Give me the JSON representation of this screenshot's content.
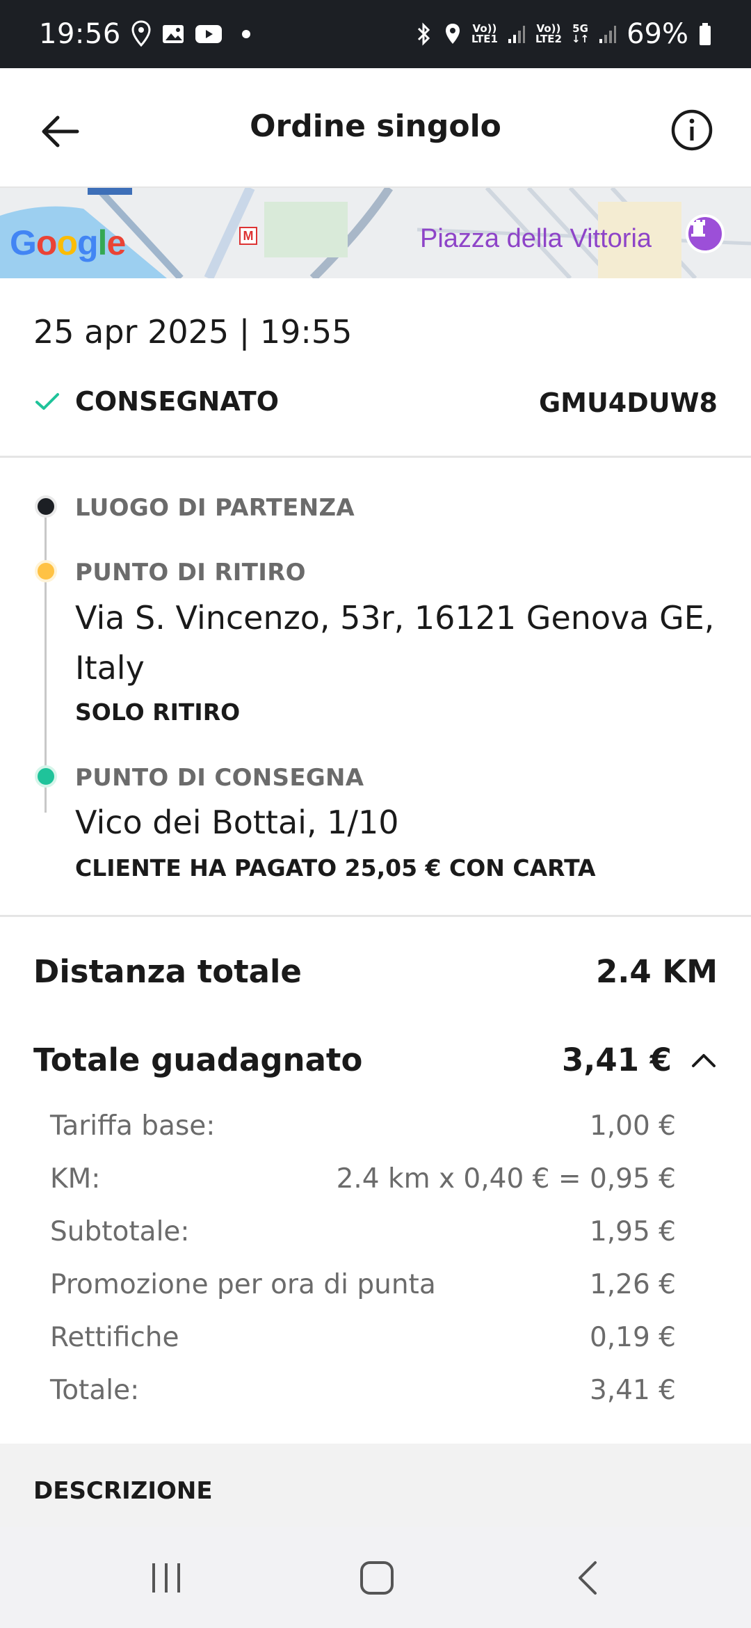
{
  "status_bar": {
    "time": "19:56",
    "sim1_top": "Vo))",
    "sim1_bottom": "LTE1",
    "sim2_top": "Vo))",
    "sim2_bottom": "LTE2",
    "network": "5G",
    "battery": "69%"
  },
  "header": {
    "title": "Ordine singolo"
  },
  "map": {
    "place_label": "Piazza della Vittoria",
    "google_letters": [
      "G",
      "o",
      "o",
      "g",
      "l",
      "e"
    ],
    "google_colors": [
      "#4285F4",
      "#EA4335",
      "#FBBC05",
      "#4285F4",
      "#34A853",
      "#EA4335"
    ],
    "metro_badge": "M"
  },
  "order": {
    "datetime": "25 apr 2025 | 19:55",
    "status": "CONSEGNATO",
    "code": "GMU4DUW8"
  },
  "route": {
    "departure": {
      "label": "LUOGO DI PARTENZA",
      "color": "#1c1f24"
    },
    "pickup": {
      "label": "PUNTO DI RITIRO",
      "address": "Via S. Vincenzo, 53r, 16121 Genova GE, Italy",
      "note": "SOLO RITIRO",
      "color": "#ffc244"
    },
    "delivery": {
      "label": "PUNTO DI CONSEGNA",
      "address": "Vico dei Bottai, 1/10",
      "note": "CLIENTE HA PAGATO 25,05 € CON CARTA",
      "color": "#1fc39a"
    }
  },
  "summary": {
    "distance_label": "Distanza totale",
    "distance_value": "2.4 KM",
    "earned_label": "Totale guadagnato",
    "earned_value": "3,41 €",
    "breakdown": [
      {
        "label": "Tariffa base:",
        "value": "1,00 €"
      },
      {
        "label": "KM:",
        "value": "2.4 km x 0,40 € = 0,95 €"
      },
      {
        "label": "Subtotale:",
        "value": "1,95 €"
      },
      {
        "label": "Promozione per ora di punta",
        "value": "1,26 €"
      },
      {
        "label": "Rettifiche",
        "value": "0,19 €"
      },
      {
        "label": "Totale:",
        "value": "3,41 €"
      }
    ]
  },
  "description": {
    "title": "DESCRIZIONE"
  },
  "colors": {
    "accent_green": "#1fc39a",
    "map_label_purple": "#8e44c8"
  }
}
